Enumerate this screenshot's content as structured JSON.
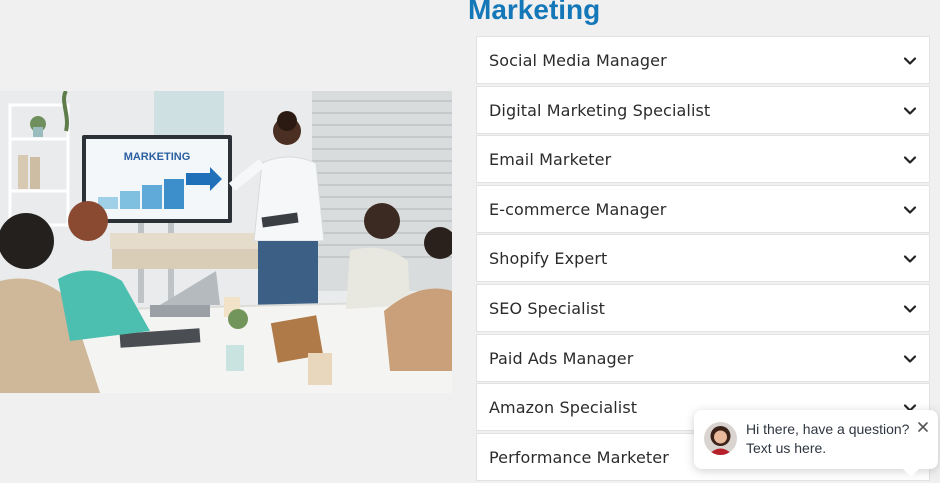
{
  "section": {
    "title": "Marketing"
  },
  "photo": {
    "screen_text": "MARKETING"
  },
  "accordion": {
    "items": [
      {
        "label": "Social Media Manager"
      },
      {
        "label": "Digital Marketing Specialist"
      },
      {
        "label": "Email Marketer"
      },
      {
        "label": "E-commerce Manager"
      },
      {
        "label": "Shopify Expert"
      },
      {
        "label": "SEO Specialist"
      },
      {
        "label": "Paid Ads Manager"
      },
      {
        "label": "Amazon Specialist"
      },
      {
        "label": "Performance Marketer"
      }
    ]
  },
  "chat": {
    "message_line1": "Hi there, have a question?",
    "message_line2": "Text us here."
  },
  "colors": {
    "accent": "#1377b8",
    "background": "#f0f0f0",
    "item_text": "#2b2b2b"
  },
  "icons": {
    "accordion_toggle": "chevron-down-icon",
    "chat_close": "close-icon"
  }
}
